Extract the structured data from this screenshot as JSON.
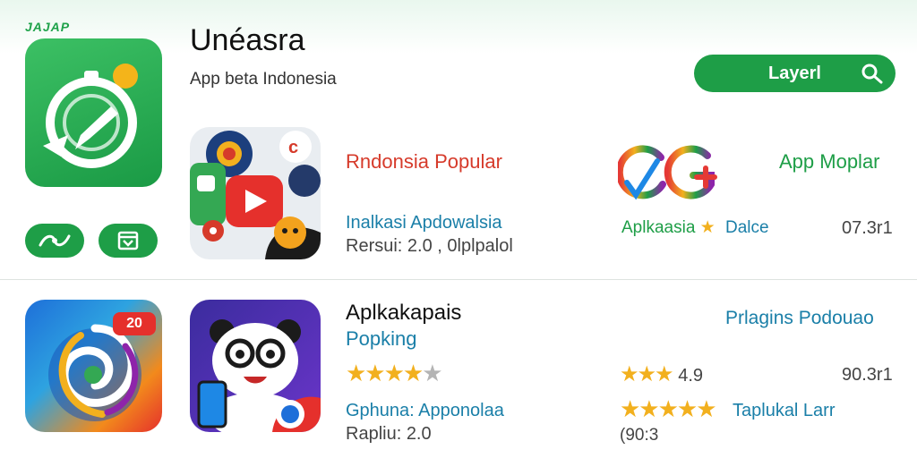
{
  "brand_mark": "JAJAP",
  "header": {
    "title": "Unéasra",
    "subtitle": "App beta Indonesia",
    "search_label": "Layerl"
  },
  "sidebar": {
    "badge_text": "20"
  },
  "row1": {
    "heading": "Rndonsia Popular",
    "line1": "Inalkasi Apdowalsia",
    "line2": "Rersui: 2.0 , 0lplpalol",
    "right_title": "App Moplar",
    "right_rating_label": "Aplkaasia",
    "right_rating_suffix": "Dalce",
    "right_value": "07.3r1",
    "logo_letters": "OG"
  },
  "row2": {
    "heading": "Aplkakapais",
    "subheading": "Popking",
    "stars_filled": 4,
    "stars_total": 5,
    "line1": "Gphuna: Apponolaa",
    "line2": "Rapliu: 2.0",
    "right_title": "Prlagins Podouao",
    "right_rating_text": "4.9",
    "right_stars_filled": 3,
    "right_value": "90.3r1",
    "right_stars2_filled": 5,
    "right_line2": "Taplukal Larr",
    "right_footer": "(90:3"
  },
  "colors": {
    "brand_green": "#1e9e47",
    "accent_red": "#d63a2a",
    "accent_teal": "#1a7fa8",
    "star": "#f2b01e"
  },
  "icons": [
    "stopwatch-app-icon",
    "route-icon",
    "inbox-icon",
    "search-icon",
    "video-apps-icon",
    "og-logo-icon",
    "spiral-app-icon",
    "panda-app-icon",
    "star-icon"
  ]
}
